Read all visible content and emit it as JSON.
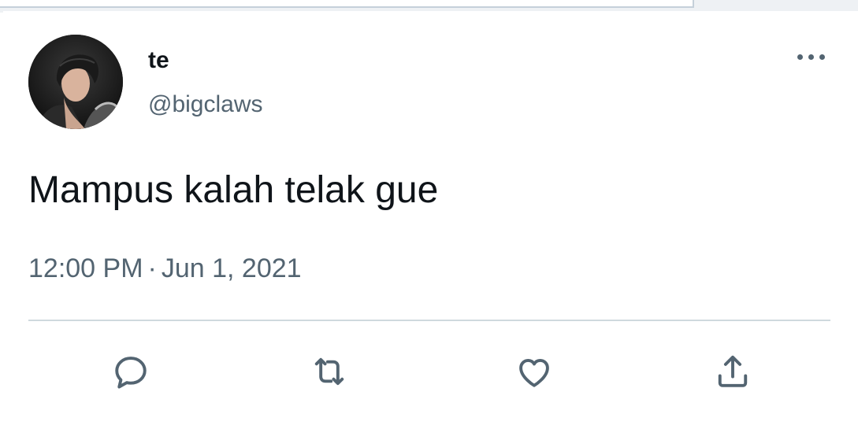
{
  "tweet": {
    "author": {
      "display_name": "te",
      "handle": "@bigclaws",
      "avatar": "avatar-photo"
    },
    "text": "Mampus kalah telak gue",
    "time": "12:00 PM",
    "separator": "·",
    "date": "Jun 1, 2021"
  },
  "icons": {
    "more": "more-horizontal-icon",
    "reply": "reply-icon",
    "retweet": "retweet-icon",
    "like": "heart-icon",
    "share": "share-icon"
  },
  "colors": {
    "text_primary": "#0f1419",
    "text_secondary": "#536471",
    "divider": "#cfd9de"
  }
}
